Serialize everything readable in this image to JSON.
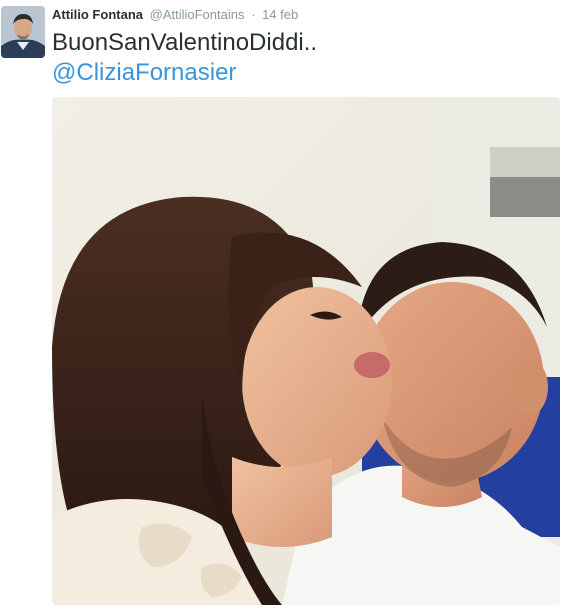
{
  "tweet": {
    "author_name": "Attilio Fontana",
    "author_handle": "@AttilioFontains",
    "separator": "·",
    "date": "14 feb",
    "text": "BuonSanValentinoDiddi..",
    "mention": "@CliziaFornasier",
    "avatar_icon": "profile-photo",
    "photo_icon": "photo-couple-kiss"
  },
  "colors": {
    "name": "#292f33",
    "meta": "#8899a6",
    "link": "#3b94d9"
  }
}
